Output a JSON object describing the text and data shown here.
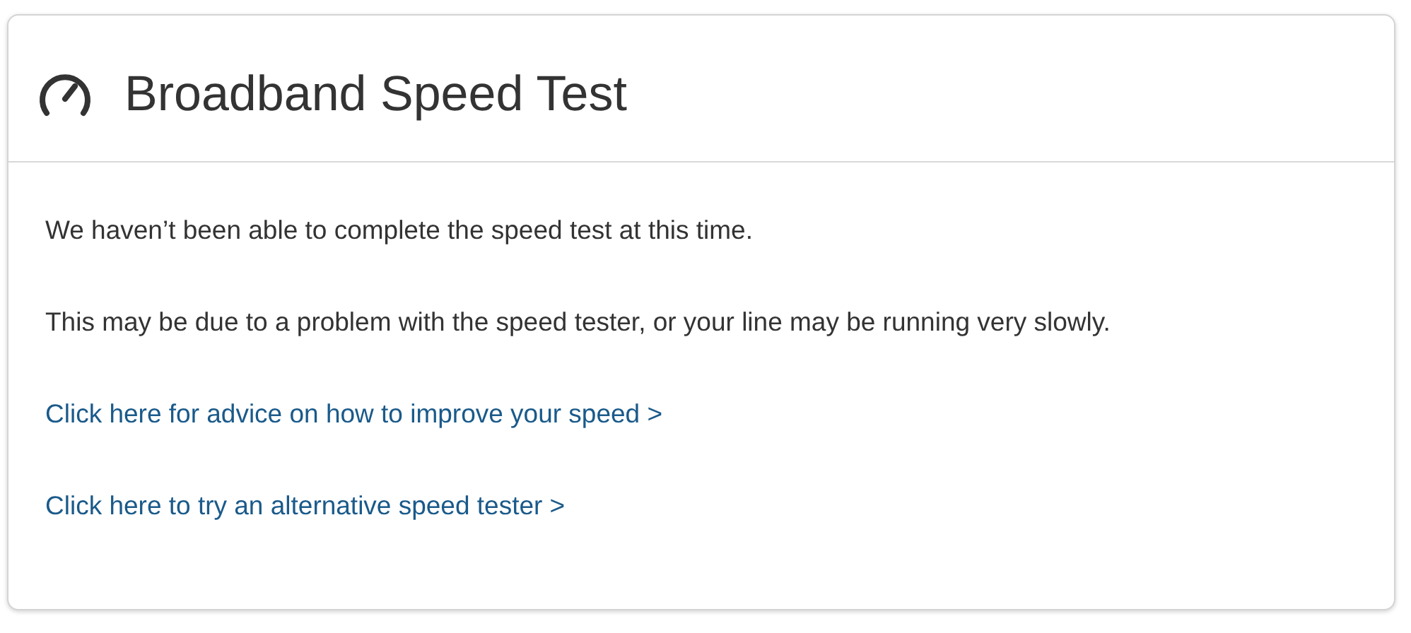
{
  "card": {
    "title": "Broadband Speed Test",
    "paragraphs": [
      {
        "kind": "text",
        "text": "We haven’t been able to complete the speed test at this time."
      },
      {
        "kind": "text",
        "text": "This may be due to a problem with the speed tester, or your line may be running very slowly."
      },
      {
        "kind": "link",
        "text": "Click here for advice on how to improve your speed >"
      },
      {
        "kind": "link",
        "text": "Click here to try an alternative speed tester >"
      }
    ]
  }
}
